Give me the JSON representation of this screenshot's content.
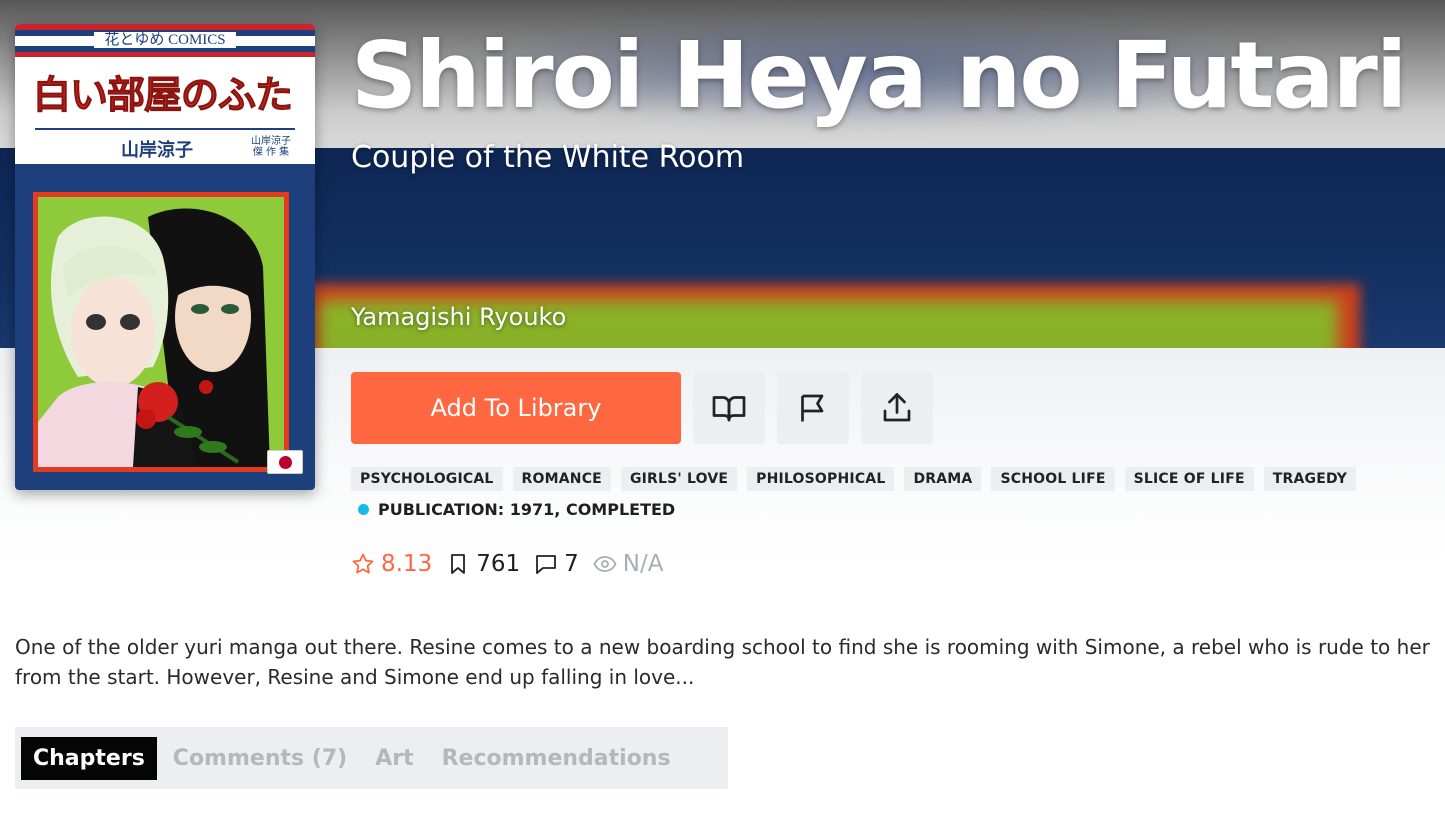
{
  "cover": {
    "imprint": "花とゆめ COMICS",
    "title_jp": "白い部屋のふたり",
    "author_jp": "山岸涼子",
    "series_jp_line1": "山岸涼子",
    "series_jp_line2": "傑 作 集",
    "flag_country": "Japan"
  },
  "manga": {
    "title": "Shiroi Heya no Futari",
    "alt_title": "Couple of the White Room",
    "author": "Yamagishi Ryouko"
  },
  "actions": {
    "add_to_library": "Add To Library",
    "read_icon": "book-open-icon",
    "report_icon": "flag-icon",
    "share_icon": "share-icon"
  },
  "tags": [
    "PSYCHOLOGICAL",
    "ROMANCE",
    "GIRLS' LOVE",
    "PHILOSOPHICAL",
    "DRAMA",
    "SCHOOL LIFE",
    "SLICE OF LIFE",
    "TRAGEDY"
  ],
  "publication": {
    "label": "PUBLICATION: 1971, COMPLETED",
    "status_color": "#18b8e9"
  },
  "stats": {
    "rating": "8.13",
    "follows": "761",
    "comments": "7",
    "views": "N/A"
  },
  "description": "One of the older yuri manga out there. Resine comes to a new boarding school to find she is rooming with Simone, a rebel who is rude to her from the start. However, Resine and Simone end up falling in love...",
  "tabs": [
    {
      "label": "Chapters",
      "active": true
    },
    {
      "label": "Comments (7)",
      "active": false
    },
    {
      "label": "Art",
      "active": false
    },
    {
      "label": "Recommendations",
      "active": false
    }
  ],
  "colors": {
    "accent": "#ff6740",
    "chip_bg": "#eceef1",
    "tab_active_bg": "#050505"
  }
}
